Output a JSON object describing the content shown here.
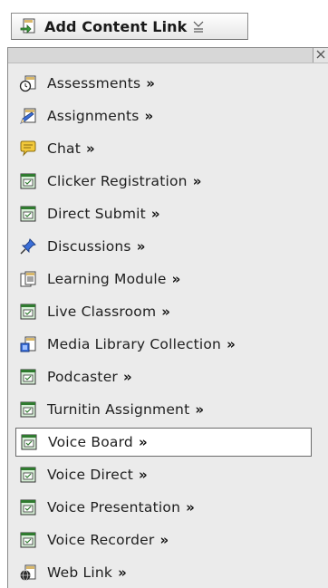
{
  "menu": {
    "button_label": "Add Content Link",
    "items": [
      {
        "label": "Assessments",
        "arrow": "»",
        "icon": "assessment-clock-icon"
      },
      {
        "label": "Assignments",
        "arrow": "»",
        "icon": "assignment-pencil-icon"
      },
      {
        "label": "Chat",
        "arrow": "»",
        "icon": "chat-bubble-icon"
      },
      {
        "label": "Clicker Registration",
        "arrow": "»",
        "icon": "tool-window-icon"
      },
      {
        "label": "Direct Submit",
        "arrow": "»",
        "icon": "tool-window-icon"
      },
      {
        "label": "Discussions",
        "arrow": "»",
        "icon": "pushpin-icon"
      },
      {
        "label": "Learning Module",
        "arrow": "»",
        "icon": "learning-module-icon"
      },
      {
        "label": "Live Classroom",
        "arrow": "»",
        "icon": "tool-window-icon"
      },
      {
        "label": "Media Library Collection",
        "arrow": "»",
        "icon": "media-library-icon"
      },
      {
        "label": "Podcaster",
        "arrow": "»",
        "icon": "tool-window-icon"
      },
      {
        "label": "Turnitin Assignment",
        "arrow": "»",
        "icon": "tool-window-icon"
      },
      {
        "label": "Voice Board",
        "arrow": "»",
        "icon": "tool-window-icon"
      },
      {
        "label": "Voice Direct",
        "arrow": "»",
        "icon": "tool-window-icon"
      },
      {
        "label": "Voice Presentation",
        "arrow": "»",
        "icon": "tool-window-icon"
      },
      {
        "label": "Voice Recorder",
        "arrow": "»",
        "icon": "tool-window-icon"
      },
      {
        "label": "Web Link",
        "arrow": "»",
        "icon": "web-link-globe-icon"
      }
    ],
    "highlighted_item": "Voice Board"
  }
}
